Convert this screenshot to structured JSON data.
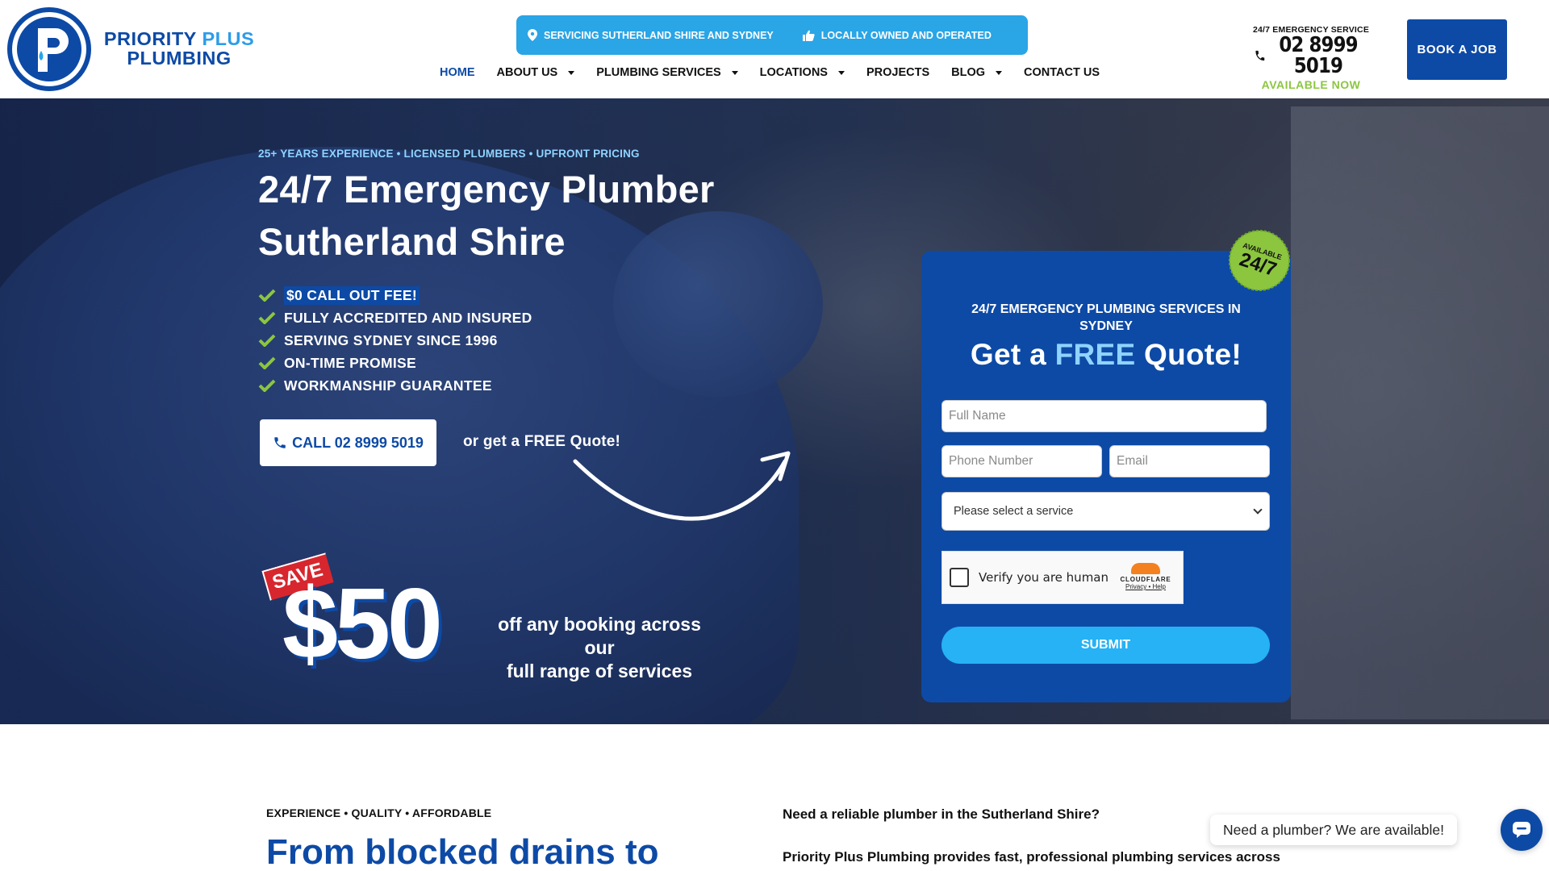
{
  "brand": {
    "name_line1_a": "PRIORITY",
    "name_line1_b": "PLUS",
    "name_line2": "PLUMBING",
    "logo_letter": "P",
    "primary_color": "#0d4aa6",
    "accent_color": "#2aa5e6"
  },
  "topbar": {
    "items": [
      {
        "label": "SERVICING SUTHERLAND SHIRE AND SYDNEY",
        "icon": "location-pin-icon"
      },
      {
        "label": "LOCALLY OWNED AND OPERATED",
        "icon": "thumbs-up-icon"
      }
    ]
  },
  "nav": {
    "items": [
      {
        "label": "HOME",
        "active": true,
        "dropdown": false
      },
      {
        "label": "ABOUT US",
        "dropdown": true
      },
      {
        "label": "PLUMBING SERVICES",
        "dropdown": true
      },
      {
        "label": "LOCATIONS",
        "dropdown": true
      },
      {
        "label": "PROJECTS",
        "dropdown": false
      },
      {
        "label": "BLOG",
        "dropdown": true
      },
      {
        "label": "CONTACT US",
        "dropdown": false
      }
    ]
  },
  "emergency": {
    "label": "24/7 EMERGENCY SERVICE",
    "phone": "02 8999 5019",
    "availability": "AVAILABLE NOW",
    "availability_color": "#8cc63f"
  },
  "book_button": "BOOK A JOB",
  "hero": {
    "kicker": "25+ YEARS EXPERIENCE • LICENSED PLUMBERS • UPFRONT PRICING",
    "title_line1": "24/7 Emergency Plumber",
    "title_line2": "Sutherland Shire",
    "checks": [
      "$0 CALL OUT FEE!",
      "FULLY ACCREDITED AND INSURED",
      "SERVING SYDNEY SINCE 1996",
      "ON-TIME PROMISE",
      "WORKMANSHIP GUARANTEE"
    ],
    "check_color": "#8cc63f",
    "call_button": "CALL 02 8999 5019",
    "or_quote": "or get a FREE Quote!",
    "save_badge": "SAVE",
    "price": "$50",
    "price_text_line1": "off any booking across our",
    "price_text_line2": "full range of services"
  },
  "quote_form": {
    "subtitle": "24/7 EMERGENCY PLUMBING SERVICES IN SYDNEY",
    "title_a": "Get a",
    "title_free": "FREE",
    "title_b": "Quote!",
    "badge_top": "AVAILABLE",
    "badge_main": "24/7",
    "full_name_placeholder": "Full Name",
    "phone_placeholder": "Phone Number",
    "email_placeholder": "Email",
    "service_select": "Please select a service",
    "captcha_label": "Verify you are human",
    "captcha_brand": "CLOUDFLARE",
    "captcha_links": "Privacy • Help",
    "submit": "SUBMIT"
  },
  "lower": {
    "kicker": "EXPERIENCE • QUALITY • AFFORDABLE",
    "title": "From blocked drains to",
    "question": "Need a reliable plumber in the Sutherland Shire?",
    "paragraph": "Priority Plus Plumbing provides fast, professional plumbing services across"
  },
  "chat": {
    "bubble": "Need a plumber? We are available!",
    "icon": "chat-icon"
  }
}
